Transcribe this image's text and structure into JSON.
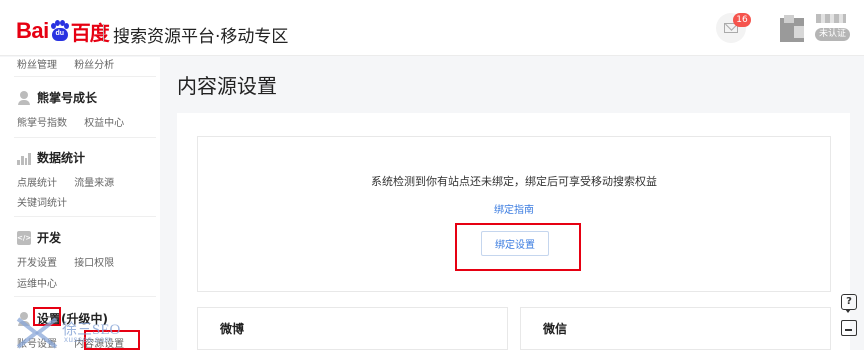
{
  "header": {
    "logo_text_latin": "Bai",
    "logo_paw_text": "du",
    "logo_text_cn": "百度",
    "title": "搜索资源平台·移动专区",
    "mail_badge_count": "16",
    "user_badge": "未认证"
  },
  "sidebar": {
    "top_links": [
      "粉丝管理",
      "粉丝分析"
    ],
    "sections": [
      {
        "title": "熊掌号成长",
        "icon": "person-icon",
        "links": [
          "熊掌号指数",
          "权益中心"
        ]
      },
      {
        "title": "数据统计",
        "icon": "bar-chart-icon",
        "links": [
          "点展统计",
          "流量来源",
          "关键词统计"
        ]
      },
      {
        "title": "开发",
        "icon": "code-icon",
        "icon_glyph": "</>",
        "links": [
          "开发设置",
          "接口权限",
          "运维中心"
        ]
      },
      {
        "title": "设置(升级中)",
        "icon": "person-icon",
        "links": [
          "账号设置",
          "内容源设置"
        ]
      }
    ]
  },
  "main": {
    "page_title": "内容源设置",
    "bind_message": "系统检测到你有站点还未绑定，绑定后可享受移动搜索权益",
    "guide_link": "绑定指南",
    "bind_button": "绑定设置",
    "cards": [
      "微博",
      "微信"
    ]
  },
  "float_tools": {
    "help_glyph": "?"
  },
  "watermark": {
    "text": "徐三SEO",
    "url": "xusseo.com"
  },
  "colors": {
    "brand_red": "#e60012",
    "link_blue": "#3b7ce0",
    "highlight_red": "#e60012",
    "badge_red": "#f5544d"
  }
}
